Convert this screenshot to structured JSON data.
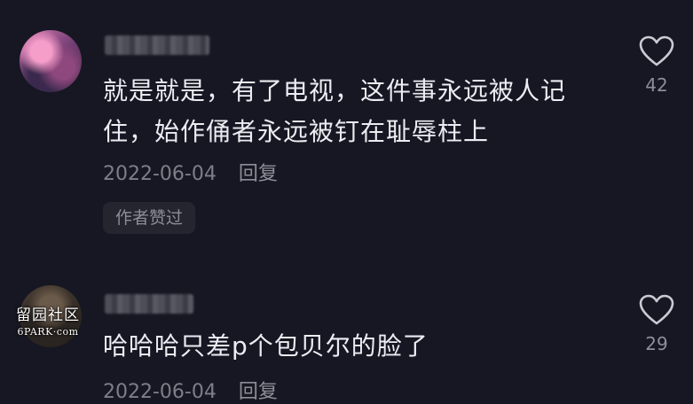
{
  "comments": [
    {
      "text_lines": [
        "就是就是，有了电视，这件事永远被人记",
        "住，始作俑者永远被钉在耻辱柱上"
      ],
      "date": "2022-06-04",
      "reply_label": "回复",
      "badge": "作者赞过",
      "likes": "42"
    },
    {
      "text_lines": [
        "哈哈哈只差p个包贝尔的脸了"
      ],
      "date": "2022-06-04",
      "reply_label": "回复",
      "likes": "29"
    }
  ],
  "watermark": {
    "cn": "留园社区",
    "en": "6PARK·com"
  },
  "colors": {
    "background": "#161722",
    "text": "#ecedf2",
    "muted": "#7d7e88",
    "badge_bg": "#24252f"
  },
  "icons": {
    "like": "heart-outline-icon"
  }
}
